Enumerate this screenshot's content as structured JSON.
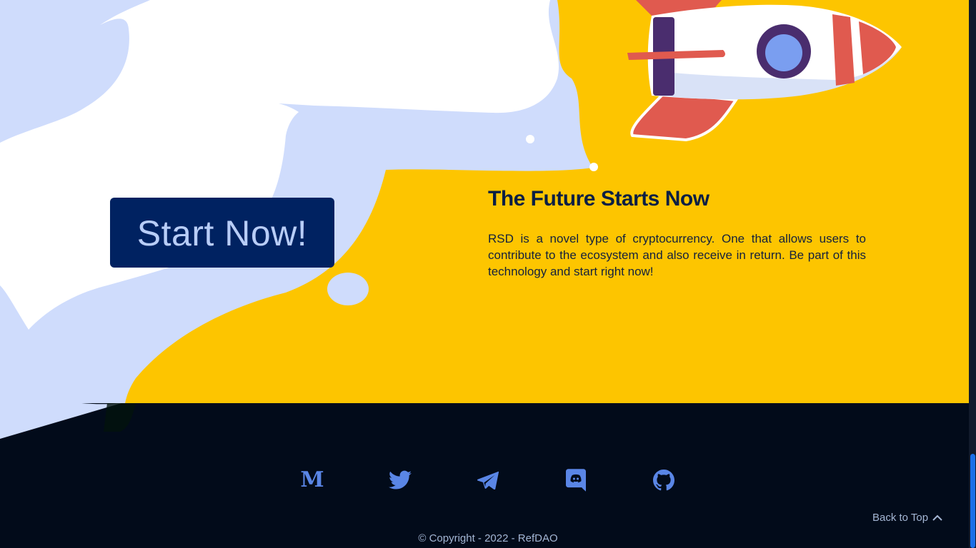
{
  "hero": {
    "cta_label": "Start Now!",
    "title": "The Future Starts Now",
    "description": "RSD is a novel type of cryptocurrency. One that allows users to contribute to the ecosystem and also receive in return. Be part of this technology and start right now!"
  },
  "footer": {
    "socials": [
      {
        "icon": "medium-icon",
        "glyph": "M"
      },
      {
        "icon": "twitter-icon"
      },
      {
        "icon": "telegram-icon"
      },
      {
        "icon": "discord-icon"
      },
      {
        "icon": "github-icon"
      }
    ],
    "back_to_top_label": "Back to Top",
    "copyright": "© Copyright - 2022 - RefDAO"
  },
  "colors": {
    "hero_background": "#fdc500",
    "footer_background": "#020b1a",
    "cloud_light": "#cfdcfc",
    "cloud_white": "#ffffff",
    "button_background": "#002261",
    "button_text": "#b8cdf7",
    "icon_color": "#5a86e6",
    "rocket_red": "#e05a4f",
    "rocket_purple": "#4a2d6e"
  }
}
